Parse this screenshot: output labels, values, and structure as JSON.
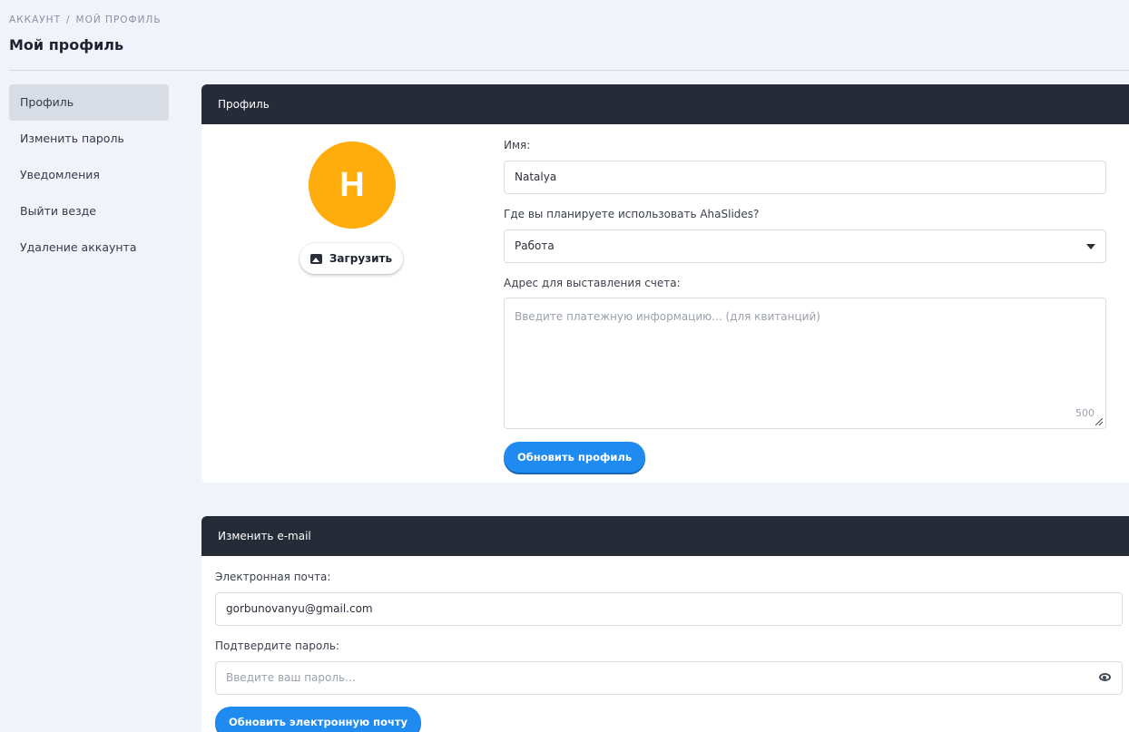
{
  "breadcrumb": {
    "parent": "АККАУНТ",
    "separator": "/",
    "current": "МОЙ ПРОФИЛЬ"
  },
  "page": {
    "title": "Мой профиль"
  },
  "sidebar": {
    "items": [
      {
        "label": "Профиль",
        "active": true
      },
      {
        "label": "Изменить пароль"
      },
      {
        "label": "Уведомления"
      },
      {
        "label": "Выйти везде"
      },
      {
        "label": "Удаление аккаунта"
      }
    ]
  },
  "profile": {
    "header": "Профиль",
    "avatar_initial": "H",
    "avatar_color": "#ffad0d",
    "upload_label": "Загрузить",
    "upload_icon": "image-icon",
    "name_label": "Имя:",
    "name_value": "Natalya",
    "usage_label": "Где вы планируете использовать AhaSlides?",
    "usage_value": "Работа",
    "billing_label": "Адрес для выставления счета:",
    "billing_placeholder": "Введите платежную информацию... (для квитанций)",
    "billing_counter": "500",
    "submit_label": "Обновить профиль"
  },
  "email": {
    "header": "Изменить e-mail",
    "email_label": "Электронная почта:",
    "email_value": "gorbunovanyu@gmail.com",
    "password_label": "Подтвердите пароль:",
    "password_placeholder": "Введите ваш пароль...",
    "password_toggle_icon": "eye-icon",
    "submit_label": "Обновить электронную почту"
  },
  "colors": {
    "accent": "#1f8bf0",
    "card_header": "#262b38",
    "background": "#f0f4fa"
  }
}
